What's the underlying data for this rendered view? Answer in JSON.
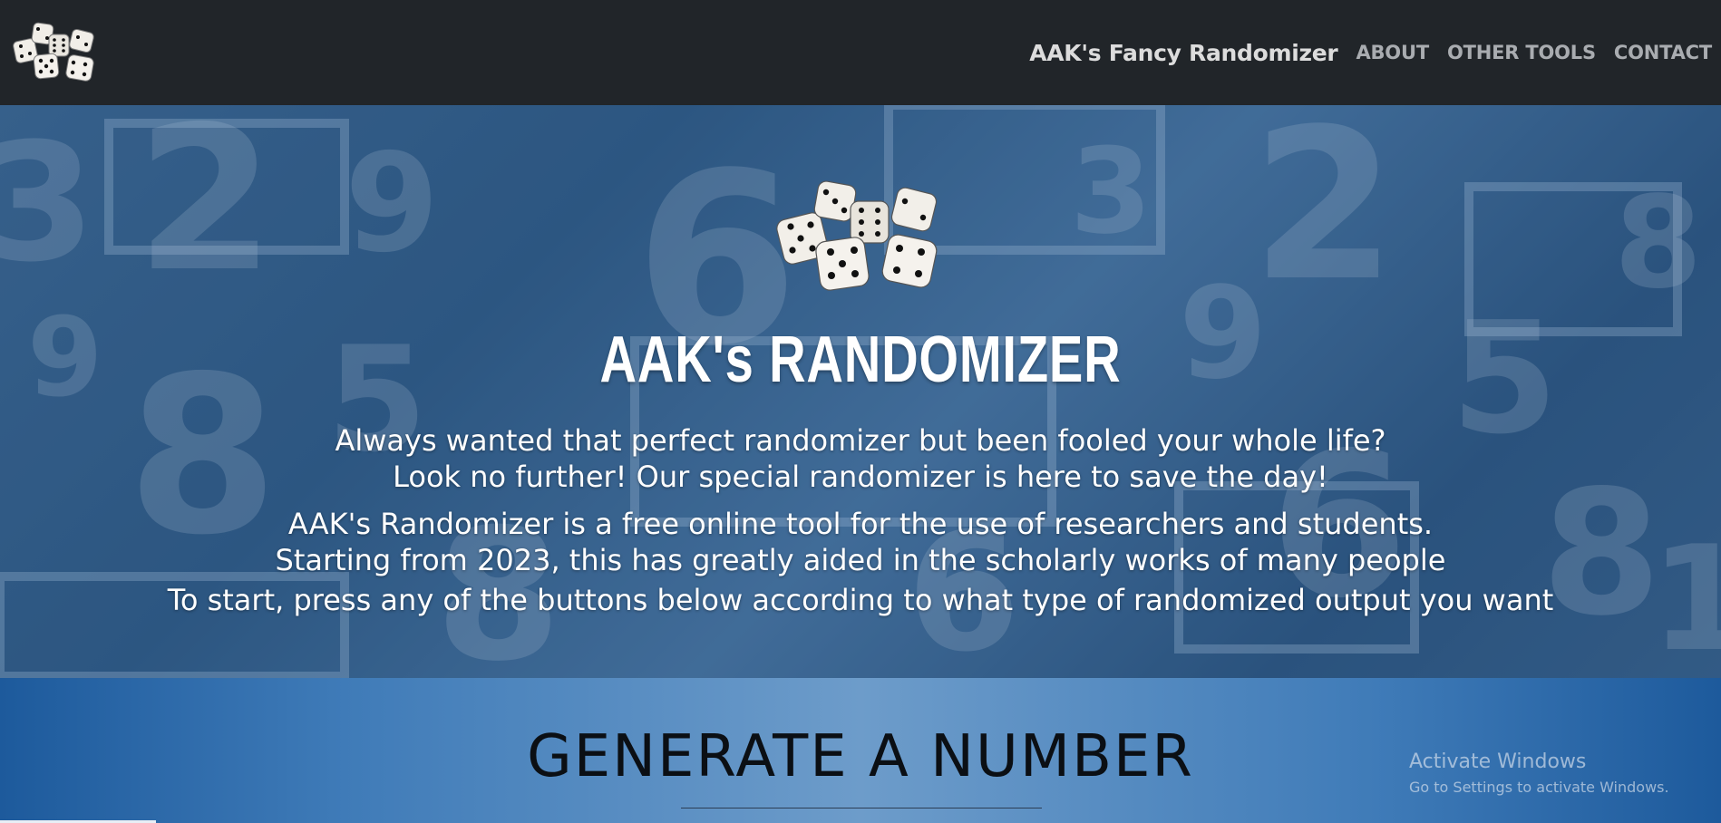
{
  "navbar": {
    "brand": "AAK's Fancy Randomizer",
    "links": [
      "ABOUT",
      "OTHER TOOLS",
      "CONTACT"
    ],
    "logo_icon": "dice-icon"
  },
  "hero": {
    "title": "AAK's RANDOMIZER",
    "paragraph1": [
      "Always wanted that perfect randomizer but been fooled your whole life?",
      "Look no further! Our special randomizer is here to save the day!"
    ],
    "paragraph2": [
      "AAK's Randomizer is a free online tool for the use of researchers and students.",
      "Starting from 2023, this has greatly aided in the scholarly works of many people"
    ],
    "paragraph3": "To start, press any of the buttons below according to what type of randomized output you want",
    "background_digits": [
      "3",
      "2",
      "9",
      "6",
      "3",
      "2",
      "8",
      "9",
      "5",
      "8",
      "9",
      "6",
      "5",
      "8",
      "6",
      "8",
      "1"
    ]
  },
  "generate": {
    "title": "GENERATE A NUMBER"
  },
  "watermark": {
    "line1": "Activate Windows",
    "line2": "Go to Settings to activate Windows."
  },
  "colors": {
    "navbar": "#212529",
    "brand_text": "#dcdcdc",
    "nav_link": "#a9acb0",
    "hero_blue": "#2e5b87",
    "section_blue": "#3f7bb8"
  }
}
